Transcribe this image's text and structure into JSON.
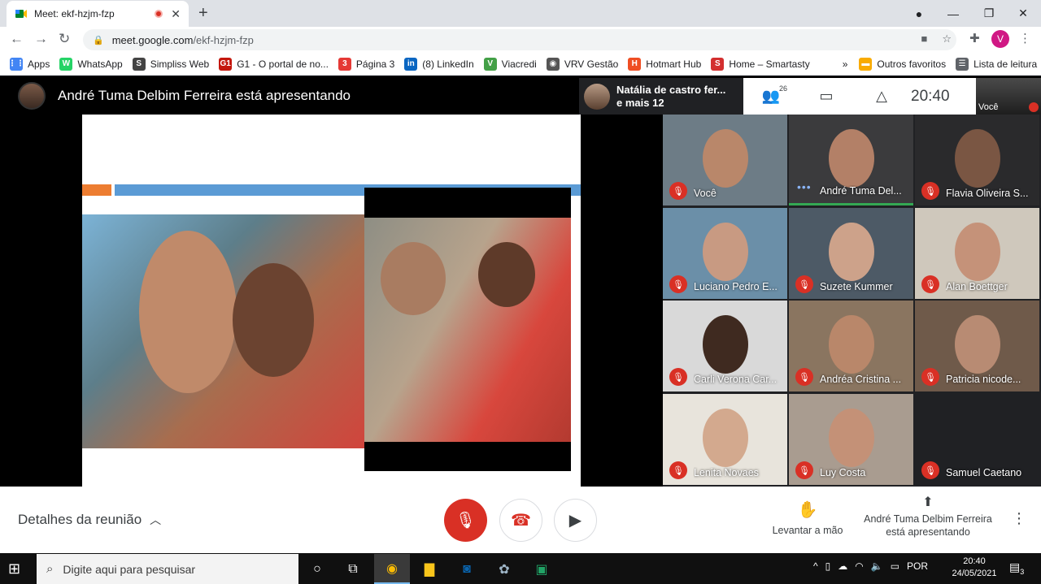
{
  "browser": {
    "tab_title": "Meet: ekf-hzjm-fzp",
    "tab_close": "✕",
    "new_tab": "+",
    "url_host": "meet.google.com",
    "url_path": "/ekf-hzjm-fzp",
    "profile_initial": "V"
  },
  "bookmarks": [
    {
      "label": "Apps",
      "color": "#4285f4",
      "glyph": "⋮⋮"
    },
    {
      "label": "WhatsApp",
      "color": "#25d366",
      "glyph": "W"
    },
    {
      "label": "Simpliss Web",
      "color": "#444444",
      "glyph": "S"
    },
    {
      "label": "G1 - O portal de no...",
      "color": "#c4170c",
      "glyph": "G1"
    },
    {
      "label": "Página 3",
      "color": "#e53935",
      "glyph": "3"
    },
    {
      "label": "(8) LinkedIn",
      "color": "#0a66c2",
      "glyph": "in"
    },
    {
      "label": "Viacredi",
      "color": "#43a047",
      "glyph": "V"
    },
    {
      "label": "VRV Gestão",
      "color": "#555555",
      "glyph": "◉"
    },
    {
      "label": "Hotmart Hub",
      "color": "#ef4e23",
      "glyph": "H"
    },
    {
      "label": "Home – Smartasty",
      "color": "#d32f2f",
      "glyph": "S"
    },
    {
      "label": "»",
      "color": "",
      "glyph": ""
    },
    {
      "label": "Outros favoritos",
      "color": "#f9ab00",
      "glyph": "▬"
    },
    {
      "label": "Lista de leitura",
      "color": "#5f6368",
      "glyph": "☰"
    }
  ],
  "meet": {
    "presenting_banner": "André Tuma Delbim Ferreira está apresentando",
    "others_label_line1": "Natália de castro fer...",
    "others_label_line2": "e mais 12",
    "participants_count": "26",
    "clock": "20:40",
    "self_label": "Você",
    "details_label": "Detalhes da reunião",
    "raise_hand_label": "Levantar a mão",
    "presenter_footer": "André Tuma Delbim Ferreira está apresentando"
  },
  "participants": [
    {
      "name": "Você",
      "muted": true,
      "bg": "#6d7c86",
      "skin": "#b9876a"
    },
    {
      "name": "André Tuma Del...",
      "muted": false,
      "speaking": true,
      "bg": "#3b3b3d",
      "skin": "#b38067"
    },
    {
      "name": "Flavia Oliveira S...",
      "muted": true,
      "bg": "#2a2a2c",
      "skin": "#7a5643"
    },
    {
      "name": "Luciano Pedro E...",
      "muted": true,
      "bg": "#6b8fa8",
      "skin": "#c89a82"
    },
    {
      "name": "Suzete Kummer",
      "muted": true,
      "bg": "#4d5a66",
      "skin": "#cda28a"
    },
    {
      "name": "Alan Boettger",
      "muted": true,
      "bg": "#cfc8bc",
      "skin": "#c59279"
    },
    {
      "name": "Carli Verona Car...",
      "muted": true,
      "bg": "#d9d9d9",
      "skin": "#3f2a20"
    },
    {
      "name": "Andréa Cristina ...",
      "muted": true,
      "bg": "#8a7560",
      "skin": "#b9876a"
    },
    {
      "name": "Patricia nicode...",
      "muted": true,
      "bg": "#6f5a4a",
      "skin": "#b88b73"
    },
    {
      "name": "Lenita Novaes",
      "muted": true,
      "bg": "#e8e4dc",
      "skin": "#d3a98e"
    },
    {
      "name": "Luy Costa",
      "muted": true,
      "bg": "#a99c90",
      "skin": "#c49177"
    },
    {
      "name": "Samuel Caetano",
      "muted": true,
      "bg": "#202124",
      "skin": "#202124"
    }
  ],
  "taskbar": {
    "search_placeholder": "Digite aqui para pesquisar",
    "language": "POR",
    "time": "20:40",
    "date": "24/05/2021",
    "notifications": "3"
  }
}
